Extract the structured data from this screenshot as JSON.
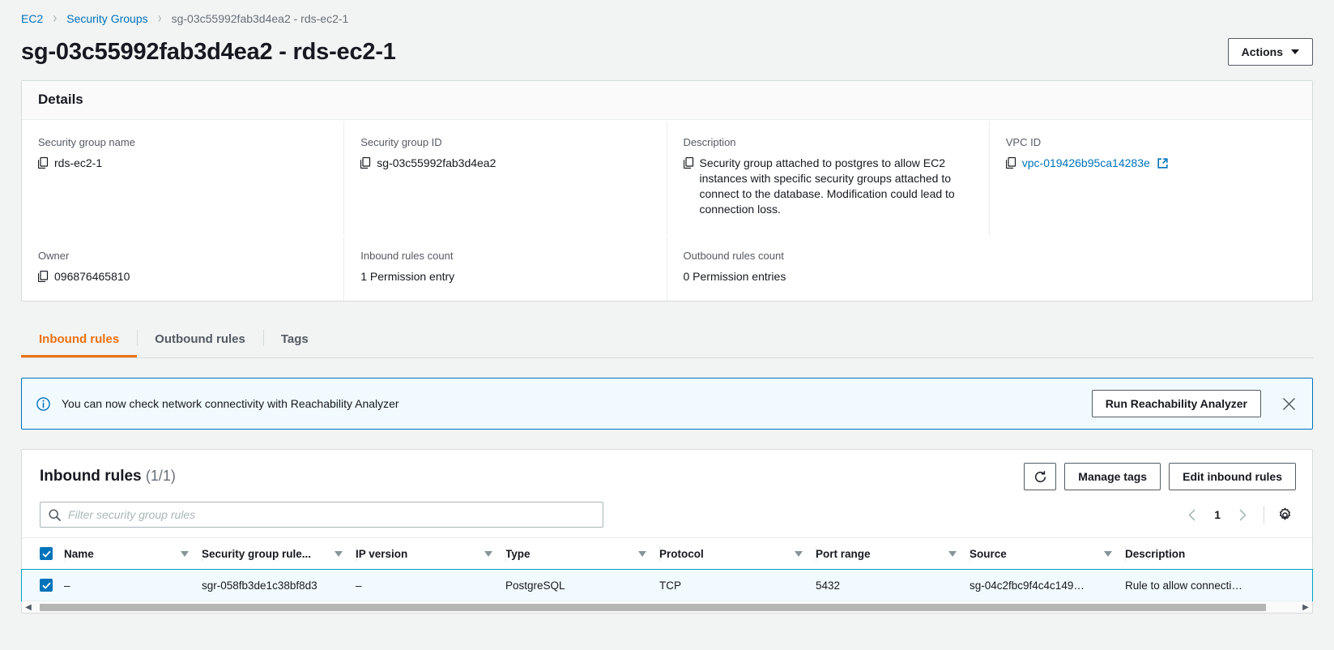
{
  "breadcrumb": {
    "items": [
      {
        "label": "EC2",
        "type": "link"
      },
      {
        "label": "Security Groups",
        "type": "link"
      },
      {
        "label": "sg-03c55992fab3d4ea2 - rds-ec2-1",
        "type": "current"
      }
    ]
  },
  "header": {
    "title": "sg-03c55992fab3d4ea2 - rds-ec2-1",
    "actions_label": "Actions"
  },
  "details": {
    "heading": "Details",
    "fields": [
      {
        "label": "Security group name",
        "value": "rds-ec2-1",
        "copyable": true
      },
      {
        "label": "Security group ID",
        "value": "sg-03c55992fab3d4ea2",
        "copyable": true
      },
      {
        "label": "Description",
        "value": "Security group attached to postgres to allow EC2 instances with specific security groups attached to connect to the database. Modification could lead to connection loss.",
        "copyable": true
      },
      {
        "label": "VPC ID",
        "value": "vpc-019426b95ca14283e",
        "copyable": true,
        "link": true,
        "external": true
      },
      {
        "label": "Owner",
        "value": "096876465810",
        "copyable": true
      },
      {
        "label": "Inbound rules count",
        "value": "1 Permission entry",
        "copyable": false
      },
      {
        "label": "Outbound rules count",
        "value": "0 Permission entries",
        "copyable": false
      }
    ]
  },
  "tabs": [
    {
      "label": "Inbound rules",
      "active": true
    },
    {
      "label": "Outbound rules",
      "active": false
    },
    {
      "label": "Tags",
      "active": false
    }
  ],
  "banner": {
    "icon": "info-icon",
    "text": "You can now check network connectivity with Reachability Analyzer",
    "button_label": "Run Reachability Analyzer",
    "close_icon": "close-icon",
    "border_color": "#0073bb",
    "background": "#f1faff"
  },
  "rules_panel": {
    "title": "Inbound rules",
    "count": "(1/1)",
    "refresh_icon": "refresh-icon",
    "manage_tags_label": "Manage tags",
    "edit_rules_label": "Edit inbound rules",
    "search": {
      "icon": "search-icon",
      "placeholder": "Filter security group rules",
      "value": ""
    },
    "pagination": {
      "prev_icon": "chevron-left-icon",
      "page": "1",
      "next_icon": "chevron-right-icon",
      "settings_icon": "gear-icon"
    },
    "columns": [
      {
        "label": "Name",
        "sortable": true
      },
      {
        "label": "Security group rule...",
        "sortable": true
      },
      {
        "label": "IP version",
        "sortable": true
      },
      {
        "label": "Type",
        "sortable": true
      },
      {
        "label": "Protocol",
        "sortable": true
      },
      {
        "label": "Port range",
        "sortable": true
      },
      {
        "label": "Source",
        "sortable": true
      },
      {
        "label": "Description",
        "sortable": false
      }
    ],
    "rows": [
      {
        "selected": true,
        "name": "–",
        "rule_id": "sgr-058fb3de1c38bf8d3",
        "ip_version": "–",
        "type": "PostgreSQL",
        "protocol": "TCP",
        "port_range": "5432",
        "source": "sg-04c2fbc9f4c4c149…",
        "description": "Rule to allow connecti…"
      }
    ]
  },
  "theme": {
    "accent_orange": "#ec7211",
    "link_blue": "#0073bb",
    "selected_row_bg": "#f1faff",
    "page_bg": "#f2f3f3"
  }
}
